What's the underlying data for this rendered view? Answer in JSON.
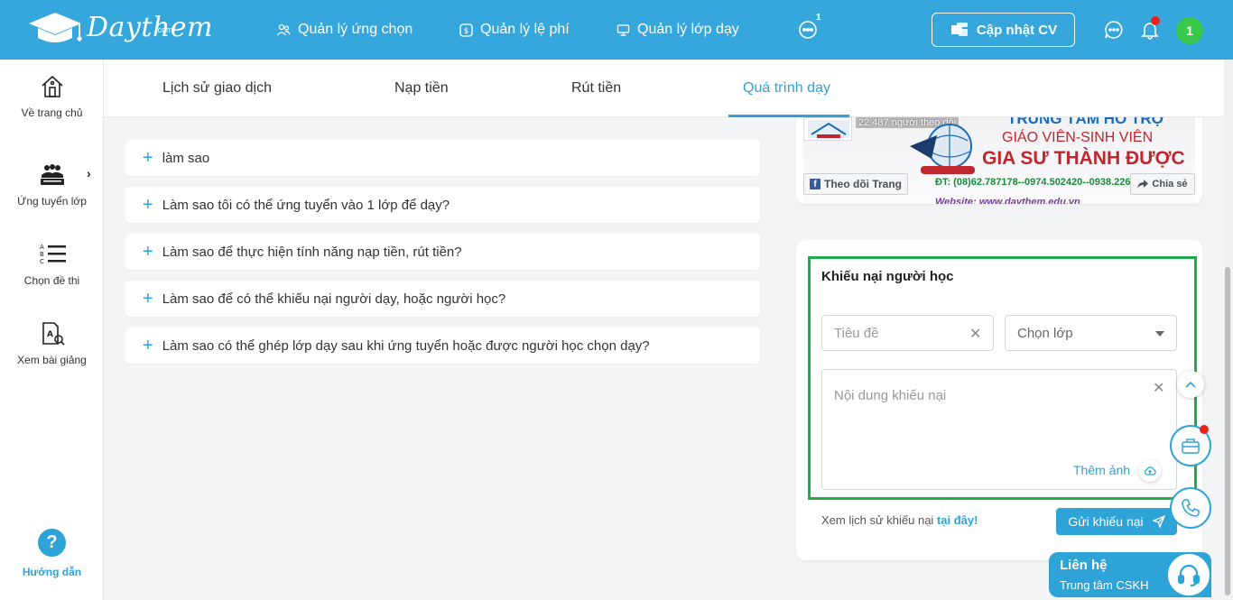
{
  "header": {
    "logo_text": "Daythem",
    "logo_suffix": ".com",
    "nav": [
      {
        "label": "Quản lý ứng chọn",
        "icon": "users-icon"
      },
      {
        "label": "Quản lý lệ phí",
        "icon": "dollar-icon"
      },
      {
        "label": "Quản lý lớp dạy",
        "icon": "monitor-icon"
      }
    ],
    "more_badge": "1",
    "cv_button": "Cập nhật CV",
    "avatar": "1"
  },
  "sidebar": {
    "items": [
      {
        "label": "Về trang chủ",
        "icon": "home-icon"
      },
      {
        "label": "Ứng tuyển lớp",
        "icon": "class-icon"
      },
      {
        "label": "Chọn đề thi",
        "icon": "list-icon"
      },
      {
        "label": "Xem bài giảng",
        "icon": "lecture-icon"
      }
    ],
    "help_label": "Hướng dẫn"
  },
  "tabs": [
    {
      "label": "Lịch sử giao dịch",
      "active": false
    },
    {
      "label": "Nạp tiền",
      "active": false
    },
    {
      "label": "Rút tiền",
      "active": false
    },
    {
      "label": "Quá trình dạy",
      "active": true
    }
  ],
  "faq": [
    "làm sao",
    "Làm sao tôi có thể ứng tuyển vào 1 lớp để dạy?",
    "Làm sao để thực hiện tính năng nạp tiền, rút tiền?",
    "Làm sao để có thể khiếu nại người dạy, hoặc người học?",
    "Làm sao có thể ghép lớp dạy sau khi ứng tuyển hoặc được người học chọn dạy?"
  ],
  "fb_card": {
    "followers": "22.487 người theo dõi",
    "line1": "TRUNG TÂM HỖ TRỢ",
    "line2": "GIÁO VIÊN-SINH VIÊN",
    "line3": "GIA SƯ THÀNH ĐƯỢC",
    "phone": "ĐT: (08)62.787178--0974.502420--0938.226",
    "website": "Website: www.daythem.edu.vn",
    "follow_button": "Theo dõi Trang",
    "share_button": "Chia sẻ"
  },
  "complaint": {
    "title": "Khiếu nại người học",
    "title_placeholder": "Tiêu đề",
    "class_select": "Chọn lớp",
    "content_placeholder": "Nội dung khiếu nại",
    "add_image": "Thêm ảnh",
    "history_text": "Xem lịch sử khiếu nại",
    "history_link": "tại đây!",
    "send_button": "Gửi khiếu nại"
  },
  "contact": {
    "title": "Liên hệ",
    "subtitle": "Trung tâm CSKH"
  },
  "colors": {
    "header": "#35a7dc",
    "accent": "#2ea3d8",
    "highlight_border": "#21a94a",
    "badge_red": "#e8231c",
    "avatar_green": "#39c84a"
  }
}
